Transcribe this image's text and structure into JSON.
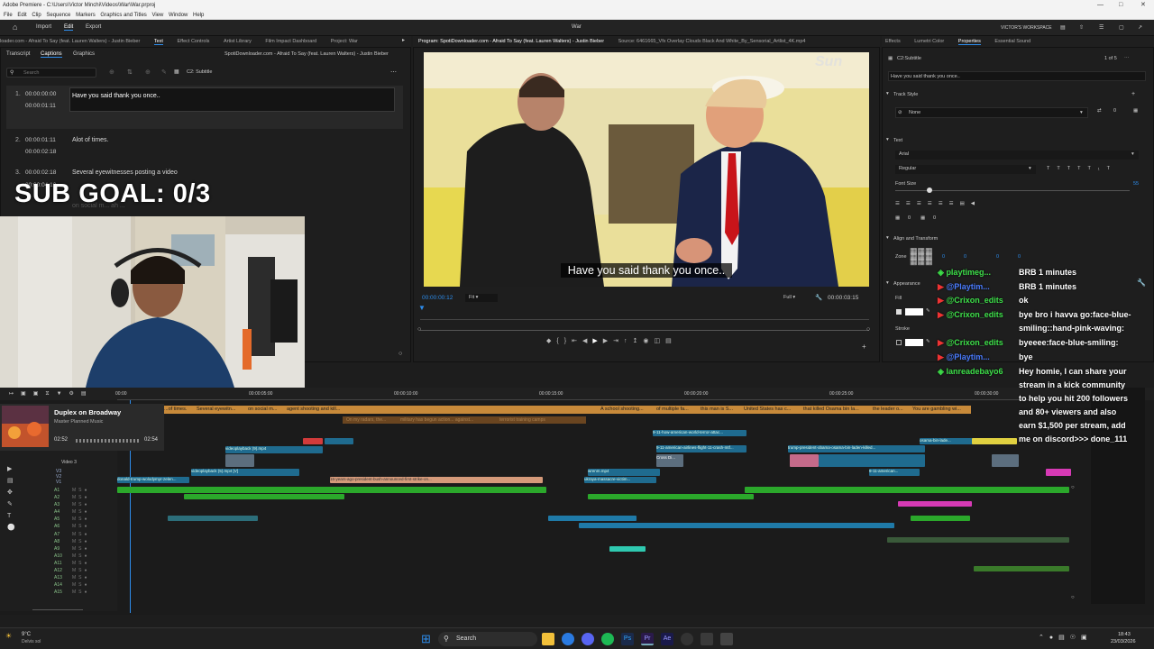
{
  "window": {
    "title": "Adobe Premiere - C:\\Users\\Victor Minchi\\Videos\\War\\War.prproj"
  },
  "menu": [
    "File",
    "Edit",
    "Clip",
    "Sequence",
    "Markers",
    "Graphics and Titles",
    "View",
    "Window",
    "Help"
  ],
  "header": {
    "nav": [
      "Import",
      "Edit",
      "Export"
    ],
    "project": "War",
    "workspace": "VICTOR'S WORKSPACE"
  },
  "left_tabs": [
    "loader.com - Afraid To Say (feat. Lauren Walters) - Justin Bieber",
    "Text",
    "Effect Controls",
    "Artist Library",
    "Film Impact Dashboard",
    "Project: War"
  ],
  "text_panel": {
    "tabs": [
      "Transcript",
      "Captions",
      "Graphics"
    ],
    "source": "SpotiDownloader.com - Afraid To Say (feat. Lauren Walters) - Justin Bieber",
    "search_placeholder": "Search",
    "track": "C2: Subtitle",
    "captions": [
      {
        "n": "1.",
        "in": "00:00:00:00",
        "out": "00:00:01:11",
        "text": "Have you said thank you once.."
      },
      {
        "n": "2.",
        "in": "00:00:01:11",
        "out": "00:00:02:18",
        "text": "Alot of times."
      },
      {
        "n": "3.",
        "in": "00:00:02:18",
        "out": "00:00:04:13",
        "text": "Several eyewitnesses posting a video"
      }
    ],
    "partial_row": "on social m... ah ..."
  },
  "overlay": {
    "sub_goal": "SUB GOAL: 0/3"
  },
  "program": {
    "label": "Program: SpotiDownloader.com - Afraid To Say (feat. Lauren Walters) - Justin Bieber",
    "source_label": "Source: 6461665_Vfx Overlay Clouds Black And White_By_Sensorial_Artlist_4K.mp4",
    "watermark": "Sun",
    "subtitle": "Have you said thank you once..",
    "timecode": "00:00:00:12",
    "fit": "Fit",
    "full": "Full",
    "duration": "00:00:03:15"
  },
  "right_tabs": [
    "Effects",
    "Lumetri Color",
    "Properties",
    "Essential Sound"
  ],
  "properties": {
    "item": "C2:Subtitle",
    "page": "1 of 5",
    "text_preview": "Have you said thank you once..",
    "track_style": "Track Style",
    "track_style_value": "None",
    "text_section": "Text",
    "font": "Arial",
    "style": "Regular",
    "font_size_label": "Font Size",
    "font_size": "55",
    "align_section": "Align and Transform",
    "zone": "Zone",
    "appearance": "Appearance",
    "fill": "Fill",
    "stroke": "Stroke",
    "zero": "0"
  },
  "chat": [
    {
      "user": "playtimeg...",
      "user_color": "#3ee04a",
      "msg": "BRB 1 minutes"
    },
    {
      "user": "@Playtim...",
      "user_color": "#4a7cff",
      "msg": "BRB 1 minutes"
    },
    {
      "user": "@Crixon_edits",
      "user_color": "#3ee04a",
      "msg": "ok"
    },
    {
      "user": "@Crixon_edits",
      "user_color": "#3ee04a",
      "msg": "bye bro i havva go:face-blue-"
    },
    {
      "user": "",
      "user_color": "#3ee04a",
      "msg": "smiling::hand-pink-waving:"
    },
    {
      "user": "@Crixon_edits",
      "user_color": "#3ee04a",
      "msg": "byeeee:face-blue-smiling:"
    },
    {
      "user": "@Playtim...",
      "user_color": "#4a7cff",
      "msg": "bye"
    },
    {
      "user": "lanreadebayo6",
      "user_color": "#3ee04a",
      "msg": "Hey homie, I can share your"
    },
    {
      "user": "",
      "user_color": "",
      "msg": "stream in a kick community"
    },
    {
      "user": "",
      "user_color": "",
      "msg": "to help you hit 200 followers"
    },
    {
      "user": "",
      "user_color": "",
      "msg": "and 80+ viewers and also"
    },
    {
      "user": "",
      "user_color": "",
      "msg": "earn $1,500 per stream, add"
    },
    {
      "user": "",
      "user_color": "",
      "msg": "me on discord>>> done_111"
    }
  ],
  "timeline": {
    "playhead": "00:00",
    "ruler": [
      "00:00:05:00",
      "00:00:10:00",
      "00:00:15:00",
      "00:00:20:00",
      "00:00:25:00",
      "00:00:30:00"
    ],
    "music": {
      "title": "Duplex on Broadway",
      "subtitle": "Master Planned Music",
      "time_a": "02:52",
      "time_b": "02:54"
    },
    "caption_clips": [
      "...of times.",
      "Several eyewitn...",
      "on social m...",
      "agent shooting and kill...",
      "A school shooting...",
      "of multiple fa...",
      "this man is S...",
      "United States has c...",
      "that killed Osama bin la...",
      "the leader o...",
      "You are gambling wi..."
    ],
    "caption_clips2": [
      "On my radars, the...",
      "military has begun action... against...",
      "terrorist training camps"
    ],
    "video_clips": [
      "9-11-how-american-world-terror-attac...",
      "videoplayback (9).mp4",
      "videoplayback (5).mp4 [V]",
      "9-11-american-airlines-flight-11-crash-mtf...",
      "trump-president-obama-osama-bin-laden-killed...",
      "osama-bin-lade...",
      "donald-trump-wolodymyr-zelen...",
      "16-years-ago-president-bush-announced-first-strike-on...",
      "wrenm.mp4",
      "ukraya-massacre-victim...",
      "Cross Di...",
      "9-11-american..."
    ],
    "tracks": [
      "V3",
      "V2",
      "V1",
      "A1",
      "A2",
      "A3",
      "A4",
      "A5",
      "A6",
      "A7",
      "A8",
      "A9",
      "A10",
      "A11",
      "A12",
      "A13",
      "A14",
      "A15"
    ],
    "video3": "Video 3"
  },
  "taskbar": {
    "weather_temp": "9°C",
    "weather_desc": "Delvis sol",
    "search": "Search",
    "time": "18:43",
    "date": "23/03/2026"
  }
}
